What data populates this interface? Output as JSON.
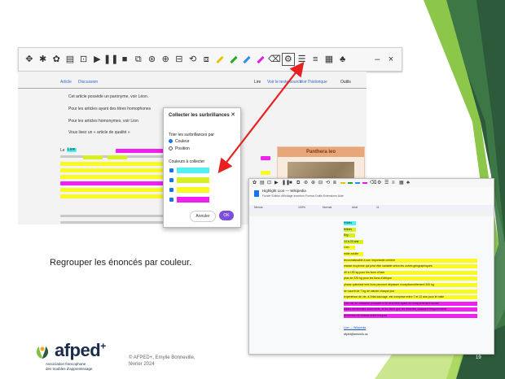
{
  "toolbar": {
    "icons": [
      {
        "name": "move-icon",
        "glyph": "✥"
      },
      {
        "name": "pin-icon",
        "glyph": "✱"
      },
      {
        "name": "flower-icon",
        "glyph": "✿"
      },
      {
        "name": "menu-icon",
        "glyph": "▤"
      },
      {
        "name": "fit-icon",
        "glyph": "⊡"
      },
      {
        "name": "play-icon",
        "glyph": "▶"
      },
      {
        "name": "pause-icon",
        "glyph": "❚❚"
      },
      {
        "name": "stop-icon",
        "glyph": "■"
      },
      {
        "name": "screenshot-icon",
        "glyph": "⧉"
      },
      {
        "name": "search-icon",
        "glyph": "⊛"
      },
      {
        "name": "zoom-icon",
        "glyph": "⊕"
      },
      {
        "name": "ocr-icon",
        "glyph": "⊟"
      },
      {
        "name": "loop-icon",
        "glyph": "⟲"
      },
      {
        "name": "translate-icon",
        "glyph": "⧈"
      },
      {
        "name": "highlighter-yellow-icon",
        "glyph": "",
        "color": "#e6c200"
      },
      {
        "name": "highlighter-green-icon",
        "glyph": "",
        "color": "#22aa22"
      },
      {
        "name": "highlighter-blue-icon",
        "glyph": "",
        "color": "#2a8cf0"
      },
      {
        "name": "highlighter-pink-icon",
        "glyph": "",
        "color": "#e020e0"
      },
      {
        "name": "eraser-icon",
        "glyph": "⌫"
      },
      {
        "name": "collect-highlights-icon",
        "glyph": "⚙"
      },
      {
        "name": "vocabulary-icon",
        "glyph": "☰"
      },
      {
        "name": "text-icon",
        "glyph": "≡"
      },
      {
        "name": "notes-icon",
        "glyph": "▦"
      },
      {
        "name": "voice-icon",
        "glyph": "♣"
      },
      {
        "name": "minimize-icon",
        "glyph": "–"
      },
      {
        "name": "close-icon",
        "glyph": "×"
      }
    ]
  },
  "wiki": {
    "tabs": {
      "article": "Article",
      "discussion": "Discussion",
      "read": "Lire",
      "edit": "Voir le texte source",
      "history": "Voir l'historique",
      "tools": "Outils"
    },
    "hatnotes": [
      "Cet article possède un paronyme, voir Léon.",
      "Pour les articles ayant des titres homophones",
      "Pour les articles homonymes, voir Lion",
      "Vous lisez un « article de qualité »"
    ],
    "first_word": "Le",
    "lion_word": "Lion",
    "infobox_title": "Panthera leo"
  },
  "dialog": {
    "title": "Collecter les surbrillances",
    "sort_label": "Trier les surbrillances par",
    "opt_color": "Couleur",
    "opt_position": "Position",
    "colors_label": "Couleurs à collecter",
    "swatches": [
      "#4ef2f2",
      "#d8ef20",
      "#fafa22",
      "#f020f0"
    ],
    "cancel": "Annuler",
    "ok": "OK"
  },
  "gdoc": {
    "title": "Highlight Lion — Wikipedia",
    "menu": "Fichier  Édition  Affichage  Insertion  Format  Outils  Extensions  Aide",
    "fmt": [
      "Menus",
      "100%",
      "Normal",
      "Arial",
      "11"
    ],
    "lines": [
      {
        "text": "félidés",
        "color": "#4ef2f2"
      },
      {
        "text": "félinés",
        "color": "#d8ef20"
      },
      {
        "text": "Erg",
        "color": "#d8ef20"
      },
      {
        "text": "14 à 20 ans",
        "color": "#d8ef20"
      },
      {
        "text": "Lion",
        "color": "#fafa22"
      },
      {
        "text": "mâle adulte",
        "color": "#fafa22"
      },
      {
        "text": "reconnaissable à son importante crinière",
        "color": "#fafa22"
      },
      {
        "text": "masse moyenne qui peut être variable selon les zones géographiques",
        "color": "#fafa22"
      },
      {
        "text": "40 à 190 kg pour les lions d'Asie",
        "color": "#fafa22"
      },
      {
        "text": "plus de 225 kg pour les lions d'Afrique",
        "color": "#fafa22"
      },
      {
        "text": "phase optimiste très lions peuvent dépasser exceptionnellement 300 kg",
        "color": "#fafa22"
      },
      {
        "text": "se nourrit de 7 kg de viande chaque jour",
        "color": "#fafa22"
      },
      {
        "text": "expérience de vie, à l'état sauvage, est comprise entre 7 et 12 ans pour le mâle",
        "color": "#fafa22"
      },
      {
        "text": "Lion est un chasseur puissant et le seul félin ayant un comportement social",
        "color": "#f020f0"
      },
      {
        "text": "mâles deviennent dominants, et les lions que les femelles chassent fréquemment",
        "color": "#f020f0"
      },
      {
        "text": "territoires de chasse entre troupes",
        "color": "#f020f0"
      },
      {
        "text": "",
        "color": ""
      },
      {
        "text": "Lion — Wikipédia",
        "color": "link"
      },
      {
        "text": "afped@antoinfo.ca",
        "color": ""
      }
    ]
  },
  "caption": "Regrouper les énoncés par couleur.",
  "logo": {
    "name": "afped",
    "plus": "+",
    "sub_line1": "Association francophone",
    "sub_line2": "des troubles d'apprentissage"
  },
  "footer": {
    "line1": "© AFPED+, Emylie Bonneville,",
    "line2": "février 2024"
  },
  "page_number": "19",
  "colors": {
    "accent_dark": "#1f4f2f",
    "accent_green": "#7ec242",
    "arrow": "#e82020"
  }
}
